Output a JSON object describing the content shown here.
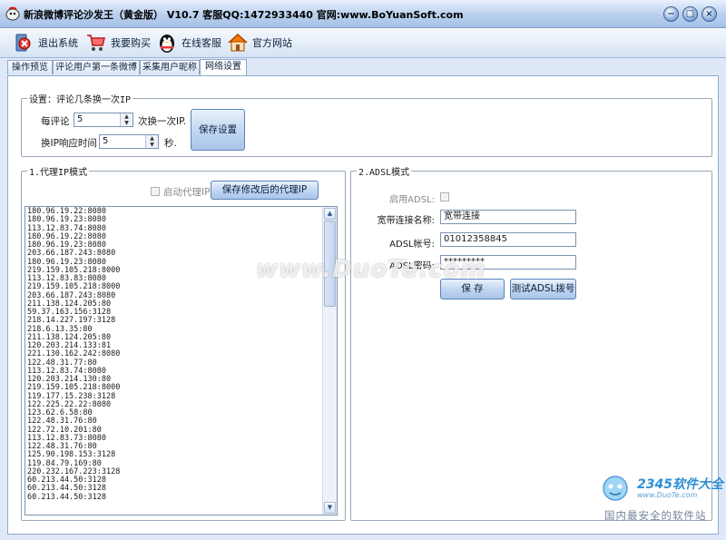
{
  "window": {
    "title": "新浪微博评论沙发王（黄金版） V10.7 客服QQ:1472933440 官网:www.BoYuanSoft.com"
  },
  "toolbar": {
    "exit": "退出系统",
    "buy": "我要购买",
    "support": "在线客服",
    "website": "官方网站"
  },
  "tabs": [
    "操作预览",
    "评论用户第一条微博",
    "采集用户昵称",
    "网络设置"
  ],
  "settings": {
    "title": "设置：评论几条换一次IP",
    "per_comment_label": "每评论",
    "per_comment_value": "5",
    "per_comment_suffix": "次换一次IP.",
    "response_label": "换IP响应时间",
    "response_value": "5",
    "response_unit": "秒.",
    "save_button": "保存设置"
  },
  "proxy": {
    "title": "1.代理IP模式",
    "enable_label": "启动代理IP",
    "enable_checked": false,
    "save_button": "保存修改后的代理IP",
    "list": [
      "180.96.19.22:8080",
      "180.96.19.23:8080",
      "113.12.83.74:8080",
      "180.96.19.22:8080",
      "180.96.19.23:8080",
      "203.66.187.243:8080",
      "180.96.19.23:8080",
      "219.159.105.218:8000",
      "113.12.83.83:8080",
      "219.159.105.218:8000",
      "203.66.187.243:8080",
      "211.138.124.205:80",
      "59.37.163.156:3128",
      "218.14.227.197:3128",
      "218.6.13.35:80",
      "211.138.124.205:80",
      "120.203.214.133:81",
      "221.130.162.242:8080",
      "122.48.31.77:80",
      "113.12.83.74:8080",
      "120.203.214.130:80",
      "219.159.105.218:8000",
      "119.177.15.238:3128",
      "122.225.22.22:8080",
      "123.62.6.58:80",
      "122.48.31.76:80",
      "122.72.10.201:80",
      "113.12.83.73:8080",
      "122.48.31.76:80",
      "125.90.198.153:3128",
      "119.84.79.169:80",
      "220.232.167.223:3128",
      "60.213.44.50:3128",
      "60.213.44.50:3128",
      "60.213.44.50:3128"
    ]
  },
  "adsl": {
    "title": "2.ADSL模式",
    "enable_label": "启用ADSL:",
    "enable_checked": false,
    "connection_label": "宽带连接名称:",
    "connection_value": "宽带连接",
    "account_label": "ADSL帐号:",
    "account_value": "01012358845",
    "password_label": "ADSL密码:",
    "password_value": "*********",
    "save_button": "保 存",
    "test_button": "测试ADSL拨号"
  },
  "watermarks": {
    "duote": "www.DuoTe.com",
    "brand": "2345软件大全",
    "site": "www.DuoTe.com",
    "slogan": "国内最安全的软件站"
  }
}
